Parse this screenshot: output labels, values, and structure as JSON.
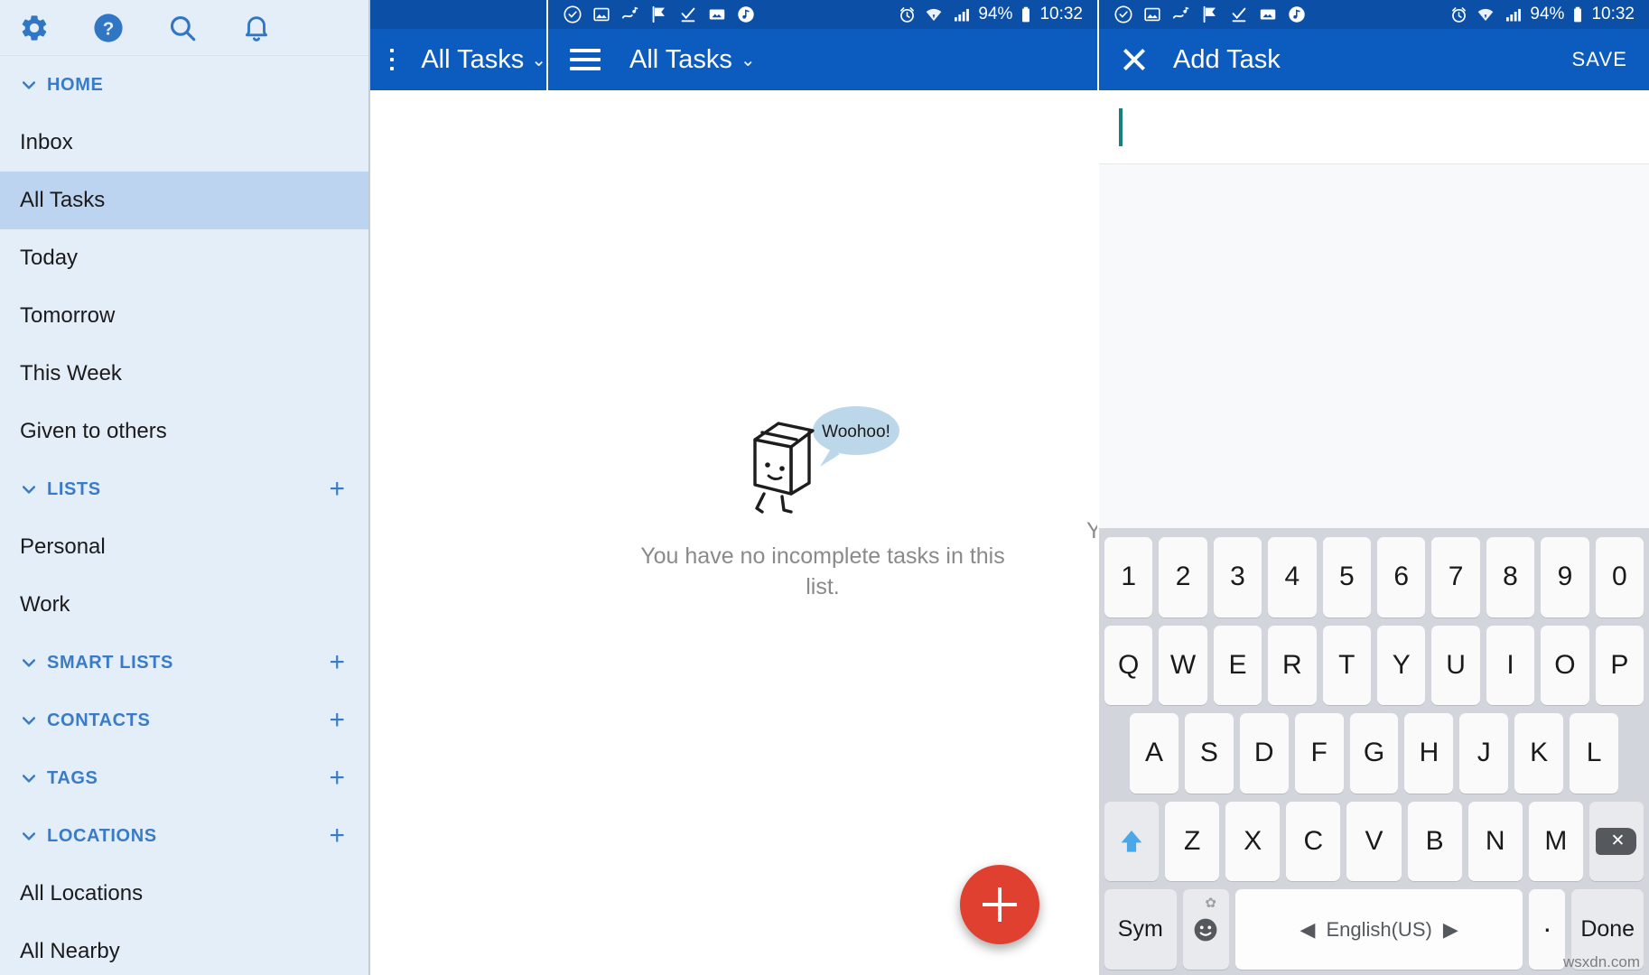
{
  "sidebar": {
    "icons": [
      {
        "name": "gear-icon",
        "label": "Settings"
      },
      {
        "name": "help-icon",
        "label": "Help"
      },
      {
        "name": "search-icon",
        "label": "Search"
      },
      {
        "name": "notifications-bell-icon",
        "label": "Notifications"
      }
    ],
    "groups": {
      "home": {
        "label": "HOME",
        "has_add": false
      },
      "lists": {
        "label": "LISTS",
        "has_add": true,
        "add": "+"
      },
      "smart_lists": {
        "label": "SMART LISTS",
        "has_add": true,
        "add": "+"
      },
      "contacts": {
        "label": "CONTACTS",
        "has_add": true,
        "add": "+"
      },
      "tags": {
        "label": "TAGS",
        "has_add": true,
        "add": "+"
      },
      "locations": {
        "label": "LOCATIONS",
        "has_add": true,
        "add": "+"
      }
    },
    "home_items": [
      {
        "label": "Inbox",
        "selected": false
      },
      {
        "label": "All Tasks",
        "selected": true
      },
      {
        "label": "Today",
        "selected": false
      },
      {
        "label": "Tomorrow",
        "selected": false
      },
      {
        "label": "This Week",
        "selected": false
      },
      {
        "label": "Given to others",
        "selected": false
      }
    ],
    "list_items": [
      {
        "label": "Personal"
      },
      {
        "label": "Work"
      }
    ],
    "location_items": [
      {
        "label": "All Locations"
      },
      {
        "label": "All Nearby"
      }
    ],
    "accent_color": "#3a7bc8",
    "selected_bg": "#bcd4ef",
    "background": "#e4eef8"
  },
  "narrow_panel": {
    "menu_icon": "hamburger-menu-icon",
    "title": "All Tasks",
    "dropdown_caret": "⌄"
  },
  "status_bar": {
    "left_icons": [
      "task-check-icon",
      "image-icon",
      "music-note-share-icon",
      "flag-check-icon",
      "checkmark-underline-icon",
      "picture-icon",
      "music-circle-icon"
    ],
    "alarm_icon": "alarm-clock-icon",
    "wifi_icon": "wifi-icon",
    "signal_icon": "cell-signal-icon",
    "battery_percent": "94%",
    "battery_icon": "battery-icon",
    "time": "10:32"
  },
  "main": {
    "menu_icon": "hamburger-menu-icon",
    "title": "All Tasks",
    "dropdown_caret": "⌄",
    "empty_state": {
      "illustration": "milk-carton-mascot",
      "speech_bubble": "Woohoo!",
      "message": "You have no incomplete tasks in this list."
    },
    "ghost_artifact": "Y",
    "fab": {
      "name": "add-task-fab",
      "label": "+",
      "color": "#e0402f"
    }
  },
  "add_task": {
    "close_icon": "close-icon",
    "title": "Add Task",
    "save_label": "SAVE",
    "input_value": "",
    "input_placeholder": "",
    "caret_color": "#18817e"
  },
  "keyboard": {
    "row1": [
      "1",
      "2",
      "3",
      "4",
      "5",
      "6",
      "7",
      "8",
      "9",
      "0"
    ],
    "row2": [
      "Q",
      "W",
      "E",
      "R",
      "T",
      "Y",
      "U",
      "I",
      "O",
      "P"
    ],
    "row3": [
      "A",
      "S",
      "D",
      "F",
      "G",
      "H",
      "J",
      "K",
      "L"
    ],
    "row4": [
      "Z",
      "X",
      "C",
      "V",
      "B",
      "N",
      "M"
    ],
    "shift_label": "⬆",
    "backspace_label": "⌫",
    "sym_label": "Sym",
    "emoji_label": "☺",
    "emoji_gear": "✿",
    "space_label": "English(US)",
    "space_prev": "◀",
    "space_next": "▶",
    "period_label": ".",
    "done_label": "Done"
  },
  "watermark": "wsxdn.com",
  "colors": {
    "app_bar": "#0c5cbf",
    "status_bar": "#0b4fa6",
    "keyboard_bg": "#d2d6dc",
    "key_bg": "#fafafa"
  }
}
